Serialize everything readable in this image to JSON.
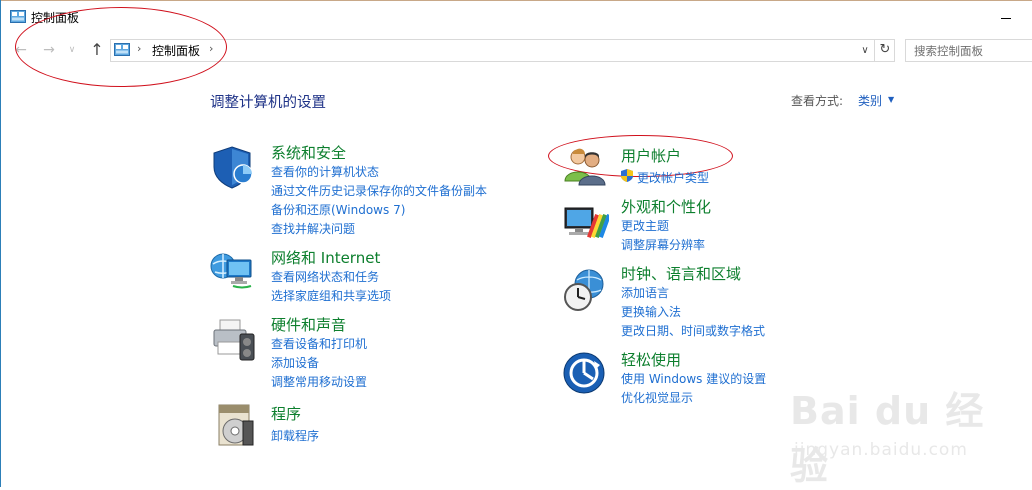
{
  "window": {
    "title": "控制面板"
  },
  "address": {
    "path_item": "控制面板",
    "search_placeholder": "搜索控制面板"
  },
  "nav": {
    "back": "←",
    "forward": "→",
    "recent": "∨",
    "up": "↑",
    "refresh": "↻",
    "dropdown": "∨"
  },
  "main": {
    "heading": "调整计算机的设置",
    "view_by_label": "查看方式:",
    "view_by_value": "类别"
  },
  "categories_left": [
    {
      "title": "系统和安全",
      "icon": "shield-icon",
      "links": [
        "查看你的计算机状态",
        "通过文件历史记录保存你的文件备份副本",
        "备份和还原(Windows 7)",
        "查找并解决问题"
      ]
    },
    {
      "title": "网络和 Internet",
      "icon": "network-icon",
      "links": [
        "查看网络状态和任务",
        "选择家庭组和共享选项"
      ]
    },
    {
      "title": "硬件和声音",
      "icon": "printer-icon",
      "links": [
        "查看设备和打印机",
        "添加设备",
        "调整常用移动设置"
      ]
    },
    {
      "title": "程序",
      "icon": "programs-icon",
      "links": [
        "卸载程序"
      ]
    }
  ],
  "categories_right": [
    {
      "title": "用户帐户",
      "icon": "users-icon",
      "links": [
        "更改帐户类型"
      ]
    },
    {
      "title": "外观和个性化",
      "icon": "monitor-paint-icon",
      "links": [
        "更改主题",
        "调整屏幕分辨率"
      ]
    },
    {
      "title": "时钟、语言和区域",
      "icon": "clock-globe-icon",
      "links": [
        "添加语言",
        "更换输入法",
        "更改日期、时间或数字格式"
      ]
    },
    {
      "title": "轻松使用",
      "icon": "ease-of-access-icon",
      "links": [
        "使用 Windows 建议的设置",
        "优化视觉显示"
      ]
    }
  ],
  "colors": {
    "category_title": "#0d7f2e",
    "link": "#1f6fd1",
    "heading": "#1e3287",
    "annotation": "#d0101c"
  },
  "watermark": {
    "brand": "Bai du 经验",
    "domain": "jingyan.baidu.com"
  }
}
